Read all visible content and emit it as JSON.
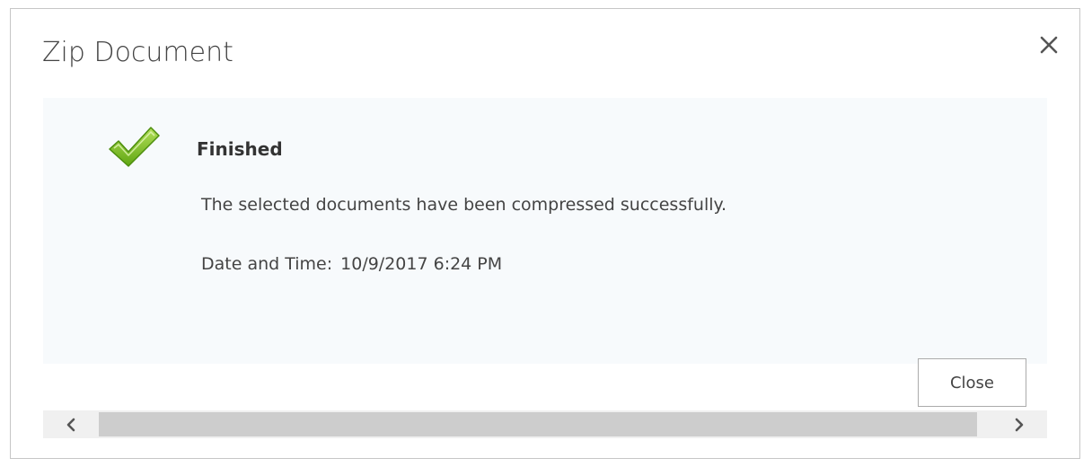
{
  "dialog": {
    "title": "Zip Document",
    "close_icon": "close-icon"
  },
  "status": {
    "icon": "checkmark-icon",
    "title": "Finished",
    "message": "The selected documents have been compressed successfully.",
    "datetime_label": "Date and Time:",
    "datetime_value": "10/9/2017 6:24 PM"
  },
  "actions": {
    "close_label": "Close"
  },
  "scrollbar": {
    "left_icon": "chevron-left-icon",
    "right_icon": "chevron-right-icon"
  },
  "colors": {
    "check_green": "#7dbf1a",
    "panel_background": "#f7fafc",
    "text": "#444444"
  }
}
